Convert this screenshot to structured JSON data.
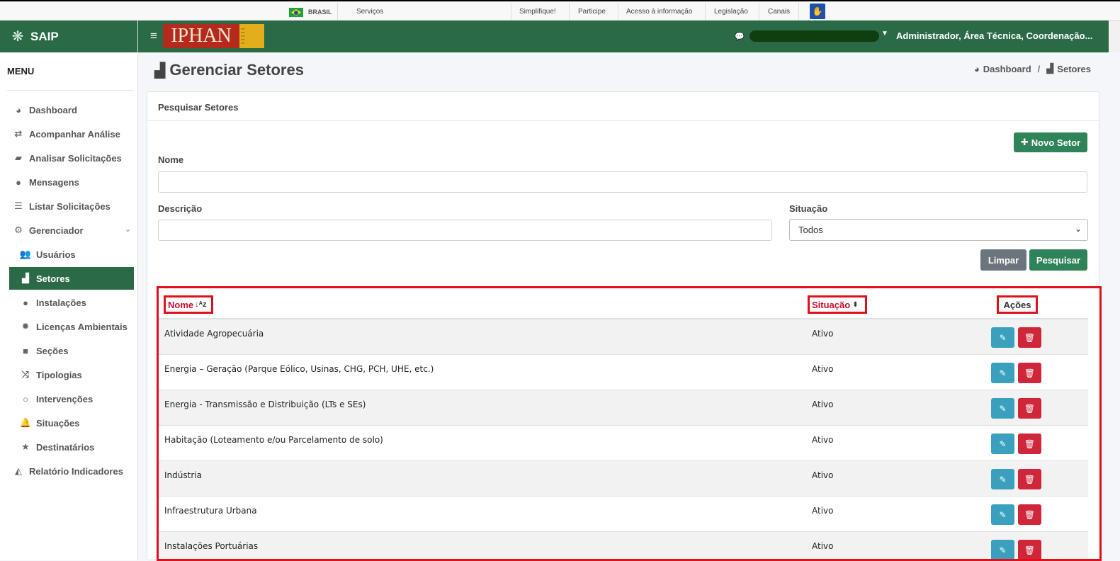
{
  "govbar": {
    "brasil": "BRASIL",
    "links": [
      "Serviços",
      "Simplifique!",
      "Participe",
      "Acesso à informação",
      "Legislação",
      "Canais"
    ]
  },
  "sidebar": {
    "brand": "SAIP",
    "menu_title": "MENU",
    "items": [
      {
        "label": "Dashboard",
        "icon": "tachometer-icon"
      },
      {
        "label": "Acompanhar Análise",
        "icon": "exchange-icon"
      },
      {
        "label": "Analisar Solicitações",
        "icon": "book-icon"
      },
      {
        "label": "Mensagens",
        "icon": "comments-icon"
      },
      {
        "label": "Listar Solicitações",
        "icon": "list-icon"
      },
      {
        "label": "Gerenciador",
        "icon": "cogs-icon"
      },
      {
        "label": "Usuários",
        "icon": "users-icon"
      },
      {
        "label": "Setores",
        "icon": "industry-icon"
      },
      {
        "label": "Instalações",
        "icon": "circle-icon"
      },
      {
        "label": "Licenças Ambientais",
        "icon": "certificate-icon"
      },
      {
        "label": "Seções",
        "icon": "square-icon"
      },
      {
        "label": "Tipologias",
        "icon": "random-icon"
      },
      {
        "label": "Intervenções",
        "icon": "circle-outline-icon"
      },
      {
        "label": "Situações",
        "icon": "bell-icon"
      },
      {
        "label": "Destinatários",
        "icon": "star-icon"
      },
      {
        "label": "Relatório Indicadores",
        "icon": "area-chart-icon"
      }
    ]
  },
  "header": {
    "logo_text": "IPHAN",
    "user": "Administrador, Área Técnica, Coordenação..."
  },
  "page": {
    "title": "Gerenciar Setores",
    "breadcrumb": [
      "Dashboard",
      "Setores"
    ]
  },
  "search": {
    "card_title": "Pesquisar Setores",
    "new_button": "Novo Setor",
    "nome_label": "Nome",
    "nome_value": "",
    "descricao_label": "Descrição",
    "descricao_value": "",
    "situacao_label": "Situação",
    "situacao_value": "Todos",
    "clear_button": "Limpar",
    "search_button": "Pesquisar"
  },
  "table": {
    "columns": [
      "Nome",
      "Situação",
      "Ações"
    ],
    "rows": [
      {
        "nome": "Atividade Agropecuária",
        "situacao": "Ativo"
      },
      {
        "nome": "Energia – Geração (Parque Eólico, Usinas, CHG, PCH, UHE, etc.)",
        "situacao": "Ativo"
      },
      {
        "nome": "Energia - Transmissão e Distribuição (LTs e SEs)",
        "situacao": "Ativo"
      },
      {
        "nome": "Habitação (Loteamento e/ou Parcelamento de solo)",
        "situacao": "Ativo"
      },
      {
        "nome": "Indústria",
        "situacao": "Ativo"
      },
      {
        "nome": "Infraestrutura Urbana",
        "situacao": "Ativo"
      },
      {
        "nome": "Instalações Portuárias",
        "situacao": "Ativo"
      }
    ]
  },
  "colors": {
    "brand_green": "#2a6a47",
    "highlight_red": "#e0101a",
    "edit_blue": "#3aa0bd",
    "delete_red": "#d0263a"
  }
}
